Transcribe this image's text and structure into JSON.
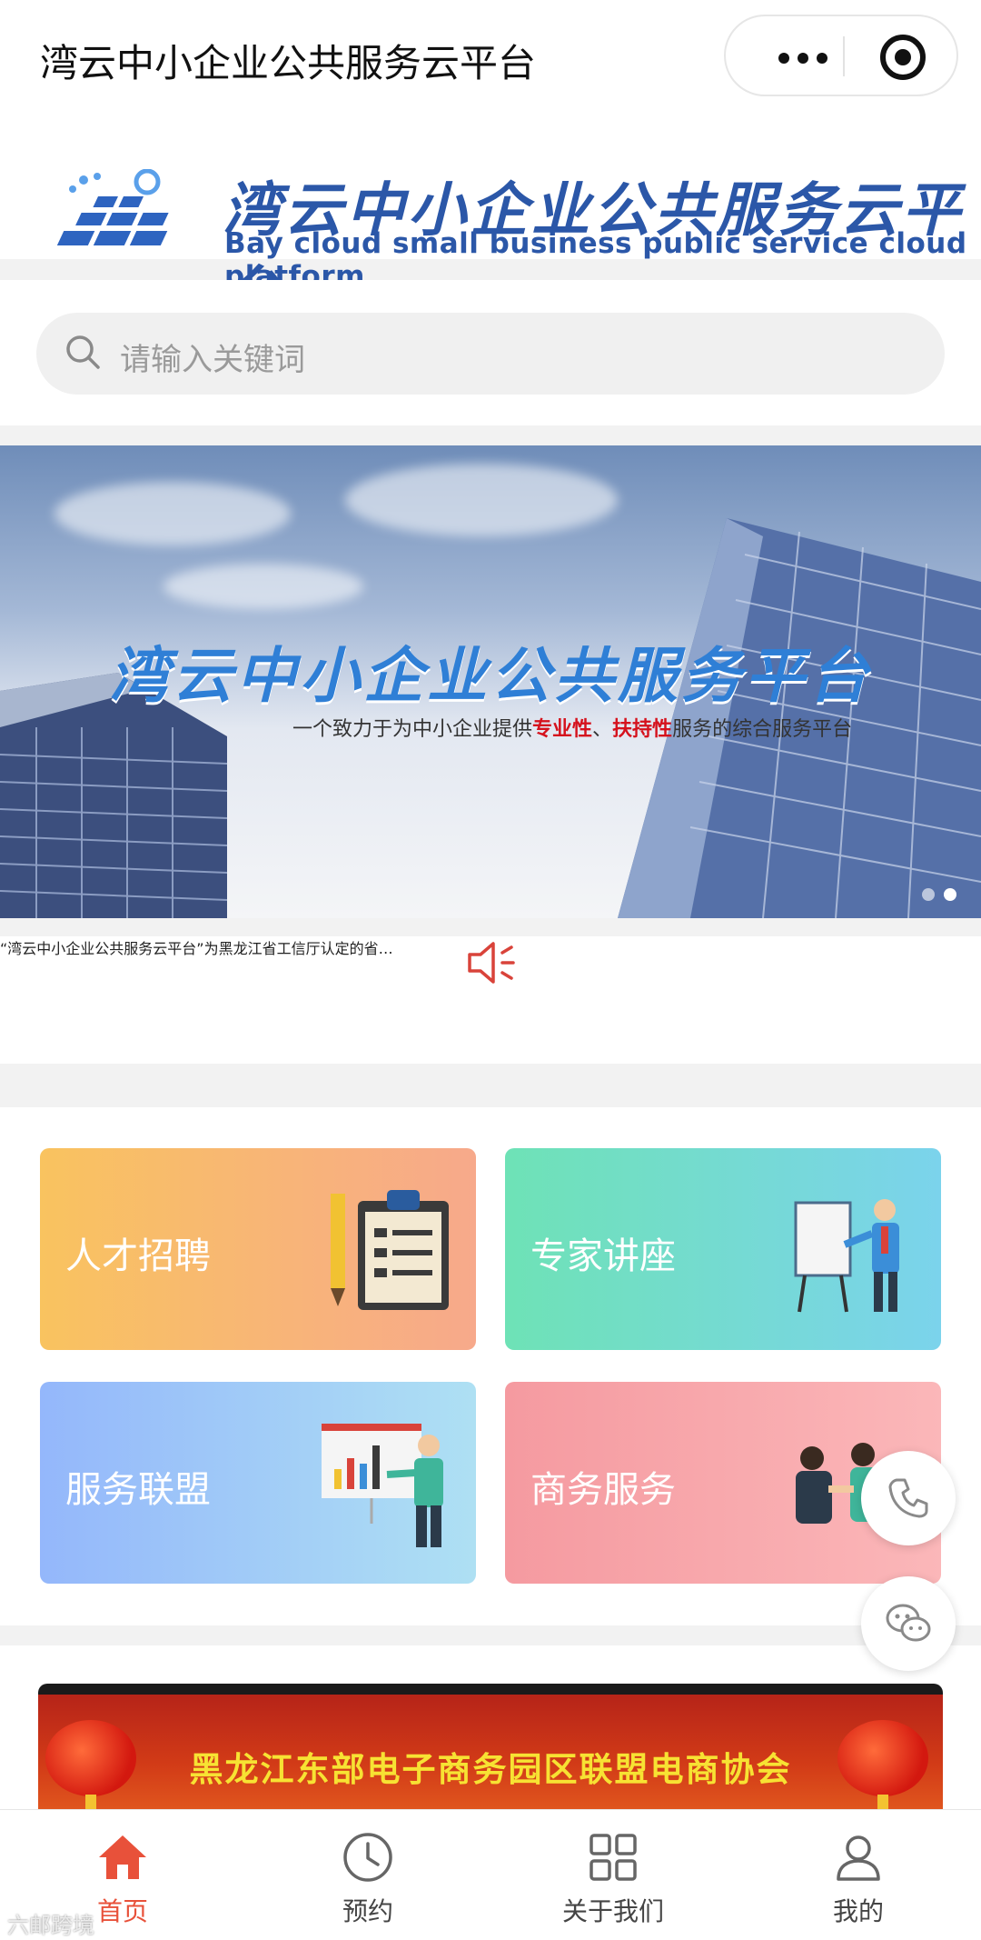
{
  "titlebar": {
    "title": "湾云中小企业公共服务云平台"
  },
  "logo": {
    "name_cn": "湾云中小企业公共服务云平台",
    "name_en": "Bay cloud small business public service cloud platform",
    "brand_color": "#2b57a8"
  },
  "search": {
    "placeholder": "请输入关键词",
    "icon": "search-icon"
  },
  "banner": {
    "title": "湾云中小企业公共服务平台",
    "subtitle_pre": "一个致力于为中小企业提供",
    "subtitle_hl1": "专业性",
    "subtitle_sep": "、",
    "subtitle_hl2": "扶持性",
    "subtitle_post": "服务的综合服务平台",
    "slide_count": 2,
    "active_slide": 2
  },
  "notice": {
    "icon": "speaker-icon",
    "text": "“湾云中小企业公共服务云平台”为黑龙江省工信厅认定的省…"
  },
  "cards": [
    {
      "label": "人才招聘",
      "icon": "clipboard-pencil-icon"
    },
    {
      "label": "专家讲座",
      "icon": "presenter-board-icon"
    },
    {
      "label": "服务联盟",
      "icon": "chart-presenter-icon"
    },
    {
      "label": "商务服务",
      "icon": "handshake-icon"
    }
  ],
  "promo": {
    "text": "黑龙江东部电子商务园区联盟电商协会"
  },
  "floating": {
    "phone_icon": "phone-icon",
    "chat_icon": "wechat-icon"
  },
  "tabs": [
    {
      "label": "首页",
      "icon": "home-icon",
      "active": true
    },
    {
      "label": "预约",
      "icon": "clock-icon",
      "active": false
    },
    {
      "label": "关于我们",
      "icon": "grid-icon",
      "active": false
    },
    {
      "label": "我的",
      "icon": "user-icon",
      "active": false
    }
  ],
  "watermark": "六邮跨境",
  "colors": {
    "accent": "#e8513a",
    "brand_blue": "#2b57a8",
    "highlight_red": "#d5121d"
  }
}
